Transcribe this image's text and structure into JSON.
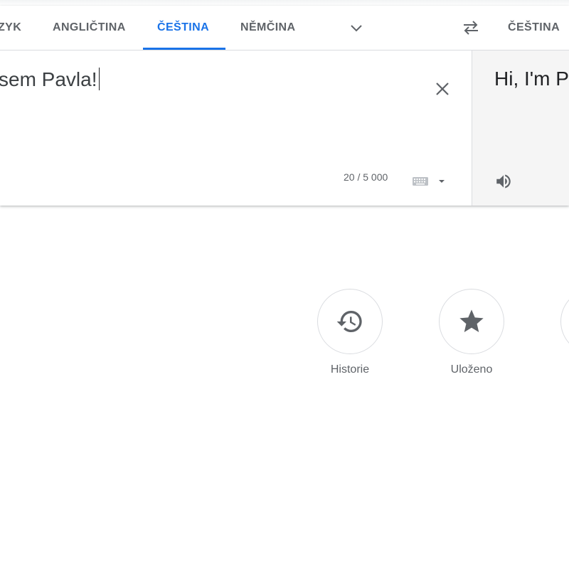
{
  "tabs": {
    "source_languages": [
      {
        "label": "ZYK"
      },
      {
        "label": "ANGLIČTINA"
      },
      {
        "label": "ČEŠTINA",
        "active": true
      },
      {
        "label": "NĚMČINA"
      }
    ],
    "target_language": "ČEŠTINA"
  },
  "source": {
    "text": "sem Pavla!",
    "char_count": "20 / 5 000"
  },
  "target": {
    "text": "Hi, I'm P"
  },
  "actions": [
    {
      "label": "Historie",
      "icon": "history-icon"
    },
    {
      "label": "Uloženo",
      "icon": "star-icon"
    }
  ],
  "colors": {
    "accent": "#1a73e8",
    "text_secondary": "#5f6368",
    "target_bg": "#f5f5f5",
    "divider": "#dadce0"
  }
}
